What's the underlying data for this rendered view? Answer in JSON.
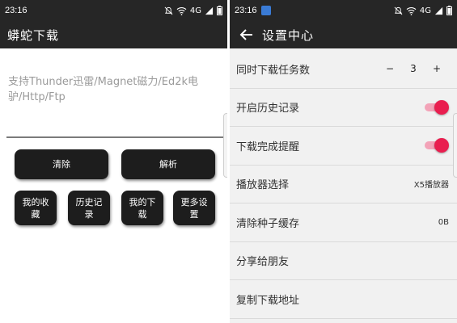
{
  "left": {
    "status_time": "23:16",
    "network_label": "4G",
    "app_title": "蟒蛇下载",
    "url_placeholder": "支持Thunder迅雷/Magnet磁力/Ed2k电驴/Http/Ftp",
    "buttons": {
      "clear": "清除",
      "parse": "解析",
      "favorites": "我的收藏",
      "history": "历史记录",
      "downloads": "我的下载",
      "settings": "更多设置"
    }
  },
  "right": {
    "status_time": "23:16",
    "network_label": "4G",
    "title": "设置中心",
    "settings": {
      "concurrent": {
        "label": "同时下载任务数",
        "minus": "−",
        "value": "3",
        "plus": "+"
      },
      "history": {
        "label": "开启历史记录",
        "enabled": true
      },
      "notify": {
        "label": "下载完成提醒",
        "enabled": true
      },
      "player": {
        "label": "播放器选择",
        "value": "X5播放器"
      },
      "cache": {
        "label": "清除种子缓存",
        "value": "0B"
      },
      "share": {
        "label": "分享给朋友"
      },
      "copy": {
        "label": "复制下载地址"
      }
    }
  },
  "colors": {
    "toolbar": "#262626",
    "button": "#1d1d1d",
    "switch_on": "#e91e4f",
    "settings_bg": "#f1f1f1"
  }
}
